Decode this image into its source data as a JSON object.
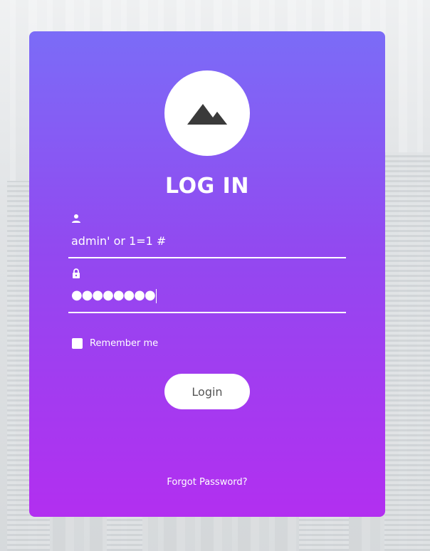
{
  "login": {
    "title": "LOG IN",
    "username": {
      "icon": "user-icon",
      "value": "admin' or 1=1 #"
    },
    "password": {
      "icon": "lock-icon",
      "value": "●●●●●●●●"
    },
    "remember_label": "Remember me",
    "remember_checked": false,
    "login_label": "Login",
    "forgot_label": "Forgot Password?",
    "logo_icon": "mountain-icon"
  },
  "colors": {
    "gradient_top": "#7b6cf7",
    "gradient_bottom": "#b22ff0",
    "text": "#ffffff",
    "button_text": "#555555"
  }
}
